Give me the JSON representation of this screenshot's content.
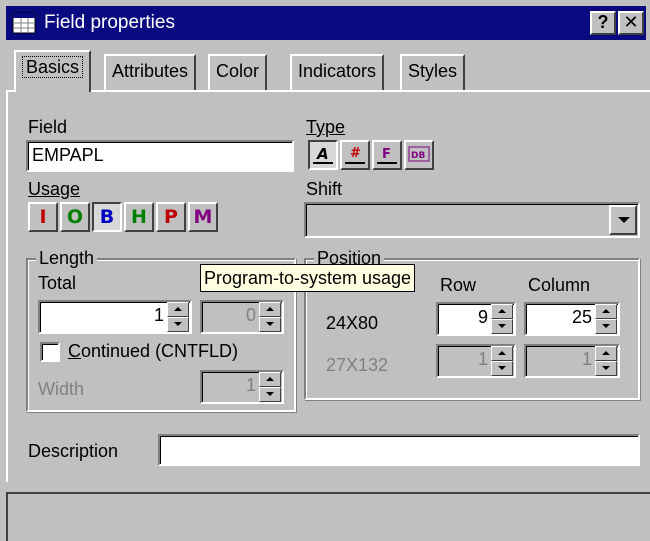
{
  "window": {
    "title": "Field properties",
    "help_button": "?",
    "close_button": "✕",
    "app_icon": "table-window-icon"
  },
  "tabs": [
    {
      "label": "Basics",
      "active": true
    },
    {
      "label": "Attributes",
      "active": false
    },
    {
      "label": "Color",
      "active": false
    },
    {
      "label": "Indicators",
      "active": false
    },
    {
      "label": "Styles",
      "active": false
    }
  ],
  "field": {
    "label": "Field",
    "value": "EMPAPL"
  },
  "type": {
    "label": "Type",
    "buttons": [
      {
        "name": "type-alphanumeric-icon",
        "glyph": "A",
        "pressed": true
      },
      {
        "name": "type-numeric-icon",
        "glyph": "#",
        "pressed": false
      },
      {
        "name": "type-float-icon",
        "glyph": "F",
        "pressed": false
      },
      {
        "name": "type-dbcs-icon",
        "glyph": "DB",
        "pressed": false
      }
    ]
  },
  "usage": {
    "label": "Usage",
    "buttons": [
      {
        "glyph": "I",
        "color": "#c00000",
        "pressed": false
      },
      {
        "glyph": "O",
        "color": "#008000",
        "pressed": false
      },
      {
        "glyph": "B",
        "color": "#0000c0",
        "pressed": true
      },
      {
        "glyph": "H",
        "color": "#008000",
        "pressed": false
      },
      {
        "glyph": "P",
        "color": "#c00000",
        "pressed": false
      },
      {
        "glyph": "M",
        "color": "#800080",
        "pressed": false
      }
    ]
  },
  "shift": {
    "label": "Shift",
    "value": ""
  },
  "length": {
    "legend": "Length",
    "total_label": "Total",
    "total_value": "1",
    "decimal_value": "0",
    "continued_label_key": "C",
    "continued_label_rest": "ontinued (CNTFLD)",
    "continued_checked": false,
    "width_label": "Width",
    "width_value": "1"
  },
  "position": {
    "legend": "Position",
    "row_label": "Row",
    "column_label": "Column",
    "rows": [
      {
        "size": "24X80",
        "row": "9",
        "column": "25",
        "enabled": true
      },
      {
        "size": "27X132",
        "row": "1",
        "column": "1",
        "enabled": false
      }
    ]
  },
  "tooltip": {
    "text": "Program-to-system usage"
  },
  "description": {
    "label": "Description",
    "value": ""
  },
  "status": {
    "text": ""
  }
}
